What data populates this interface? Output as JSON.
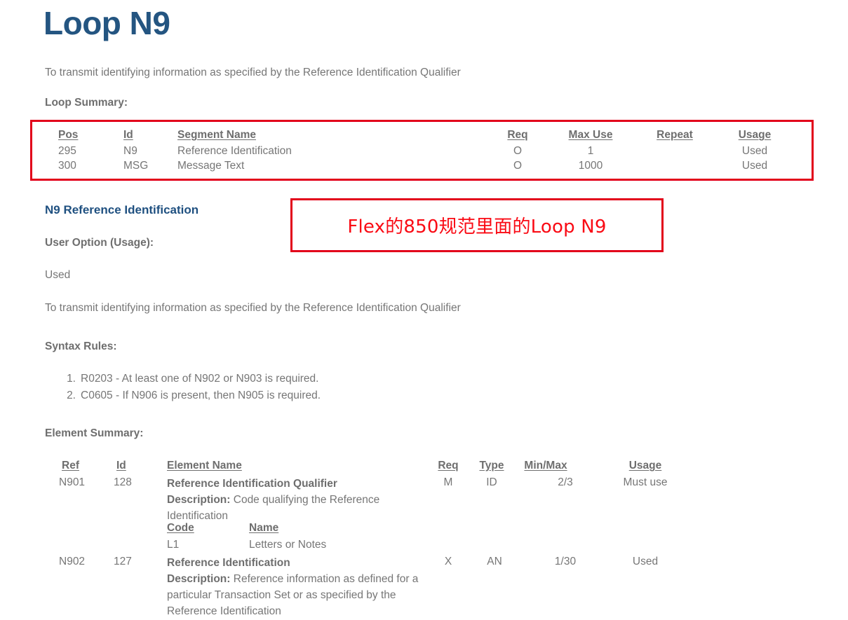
{
  "document": {
    "title": "Loop N9",
    "intro": "To transmit identifying information as specified by the Reference Identification Qualifier"
  },
  "loop_summary": {
    "label": "Loop Summary:",
    "headers": {
      "pos": "Pos",
      "id": "Id",
      "segment_name": "Segment Name",
      "req": "Req",
      "max_use": "Max Use",
      "repeat": "Repeat",
      "usage": "Usage"
    },
    "rows": [
      {
        "pos": "295",
        "id": "N9",
        "segment_name": "Reference Identification",
        "req": "O",
        "max_use": "1",
        "repeat": "",
        "usage": "Used"
      },
      {
        "pos": "300",
        "id": "MSG",
        "segment_name": "Message Text",
        "req": "O",
        "max_use": "1000",
        "repeat": "",
        "usage": "Used"
      }
    ]
  },
  "annotation": {
    "text": "Flex的850规范里面的Loop N9",
    "color": "#fa0a14"
  },
  "segment": {
    "heading": "N9 Reference Identification",
    "user_option_label": "User Option (Usage):",
    "user_option_value": "Used",
    "purpose": "To transmit identifying information as specified by the Reference Identification Qualifier",
    "syntax_rules_label": "Syntax Rules:",
    "syntax_rules": [
      {
        "num": "1.",
        "text": "R0203 - At least one of N902 or N903 is required."
      },
      {
        "num": "2.",
        "text": "C0605 - If N906 is present, then N905 is required."
      }
    ]
  },
  "element_summary": {
    "label": "Element Summary:",
    "headers": {
      "ref": "Ref",
      "id": "Id",
      "element_name": "Element Name",
      "req": "Req",
      "type": "Type",
      "minmax": "Min/Max",
      "usage": "Usage"
    },
    "code_headers": {
      "code": "Code",
      "name": "Name"
    },
    "rows": [
      {
        "ref": "N901",
        "id": "128",
        "element_name": "Reference Identification Qualifier",
        "description_label": "Description:",
        "description": "Code qualifying the Reference Identification",
        "req": "M",
        "type": "ID",
        "minmax": "2/3",
        "usage": "Must use",
        "codes": [
          {
            "code": "L1",
            "name": "Letters or Notes"
          }
        ]
      },
      {
        "ref": "N902",
        "id": "127",
        "element_name": "Reference Identification",
        "description_label": "Description:",
        "description": "Reference information as defined for a particular Transaction Set or as specified by the Reference Identification",
        "req": "X",
        "type": "AN",
        "minmax": "1/30",
        "usage": "Used",
        "codes": []
      }
    ]
  },
  "colors": {
    "heading_blue": "#245581",
    "body_gray": "#767676",
    "highlight_red": "#e2001a"
  }
}
